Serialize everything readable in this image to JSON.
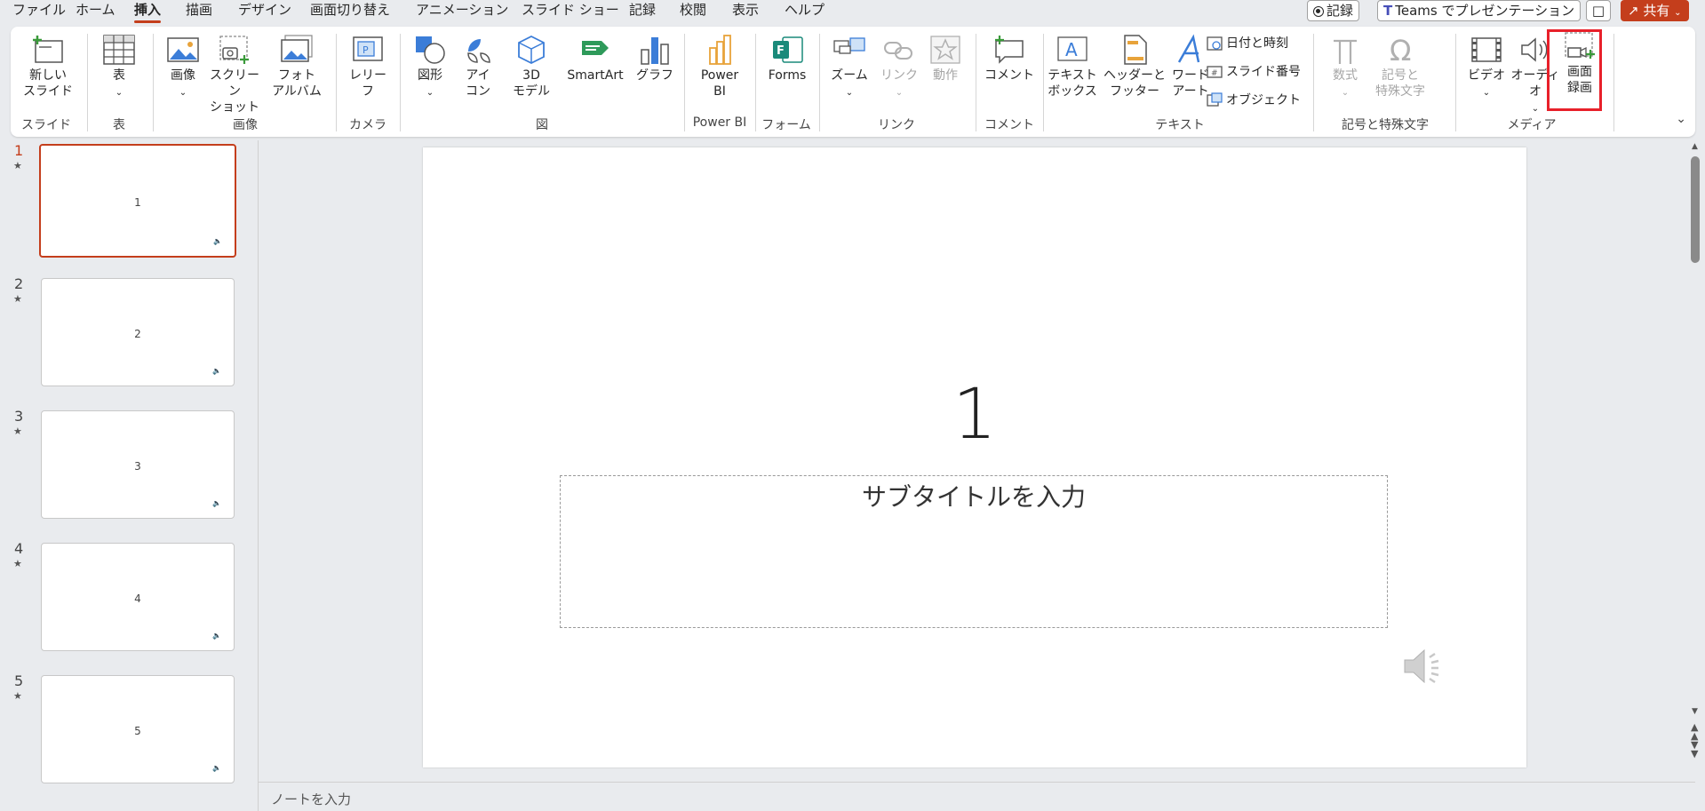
{
  "menu": {
    "tabs": [
      "ファイル",
      "ホーム",
      "挿入",
      "描画",
      "デザイン",
      "画面切り替え",
      "アニメーション",
      "スライド ショー",
      "記録",
      "校閲",
      "表示",
      "ヘルプ"
    ],
    "active_tab": "挿入",
    "record_button": "記録",
    "teams_button": "Teams でプレゼンテーション",
    "share_button": "共有"
  },
  "ribbon": {
    "new_slide": "新しい\nスライド",
    "table": "表",
    "image": "画像",
    "screenshot": "スクリーン\nショット",
    "photo_album": "フォト\nアルバム",
    "cameo": "レリー\nフ",
    "shapes": "図形",
    "icons": "アイ\nコン",
    "model3d": "3D\nモデル",
    "smartart": "SmartArt",
    "chart": "グラフ",
    "powerbi": "Power\nBI",
    "forms": "Forms",
    "zoom": "ズーム",
    "link": "リンク",
    "action": "動作",
    "comment": "コメント",
    "textbox": "テキスト\nボックス",
    "header_footer": "ヘッダーと\nフッター",
    "wordart": "ワード\nアート",
    "datetime": "日付と時刻",
    "slide_number": "スライド番号",
    "object": "オブジェクト",
    "equation": "数式",
    "symbol": "記号と\n特殊文字",
    "video": "ビデオ",
    "audio": "オーディオ",
    "screen_recording": "画面\n録画",
    "groups": {
      "slides": "スライド",
      "tables": "表",
      "images": "画像",
      "camera": "カメラ",
      "illustrations": "図",
      "powerbi": "Power BI",
      "forms": "フォーム",
      "links": "リンク",
      "comments": "コメント",
      "text": "テキスト",
      "symbols": "記号と特殊文字",
      "media": "メディア"
    }
  },
  "thumbnails": [
    {
      "num": "1",
      "label": "1"
    },
    {
      "num": "2",
      "label": "2"
    },
    {
      "num": "3",
      "label": "3"
    },
    {
      "num": "4",
      "label": "4"
    },
    {
      "num": "5",
      "label": "5"
    }
  ],
  "slide": {
    "title": "1",
    "subtitle_placeholder": "サブタイトルを入力"
  },
  "notes_placeholder": "ノートを入力",
  "colors": {
    "accent": "#c43e1c",
    "highlight": "#e8202a"
  }
}
